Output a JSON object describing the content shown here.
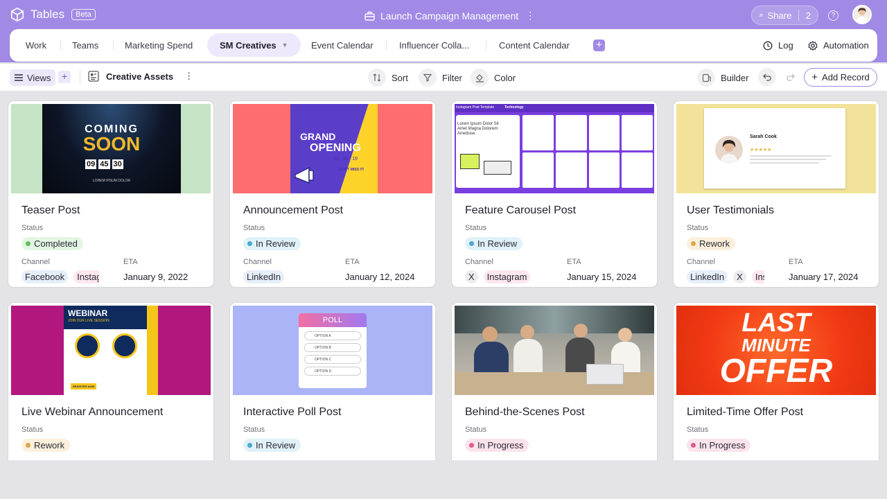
{
  "app": {
    "name": "Tables",
    "badge": "Beta"
  },
  "project": {
    "title": "Launch Campaign Management"
  },
  "share": {
    "label": "Share",
    "count": "2"
  },
  "tabs": [
    {
      "label": "Work"
    },
    {
      "label": "Teams"
    },
    {
      "label": "Marketing Spend"
    },
    {
      "label": "SM Creatives"
    },
    {
      "label": "Event Calendar"
    },
    {
      "label": "Influencer Colla..."
    },
    {
      "label": "Content Calendar"
    }
  ],
  "right_tabs": {
    "log": "Log",
    "automation": "Automation"
  },
  "toolbar": {
    "views": "Views",
    "table": "Creative Assets",
    "sort": "Sort",
    "filter": "Filter",
    "color": "Color",
    "builder": "Builder",
    "add_record": "Add Record"
  },
  "labels": {
    "status": "Status",
    "channel": "Channel",
    "eta": "ETA"
  },
  "cards": [
    {
      "title": "Teaser Post",
      "status": "Completed",
      "channels": [
        "Facebook",
        "Instagram"
      ],
      "eta": "January 9, 2022",
      "image": {
        "headline": "COMING",
        "subheadline": "SOON",
        "digits": [
          "09",
          "45",
          "30"
        ],
        "footer": "LOREM IPSUM DOLOR"
      }
    },
    {
      "title": "Announcement Post",
      "status": "In Review",
      "channels": [
        "LinkedIn"
      ],
      "eta": "January 12, 2024",
      "image": {
        "headline": "GRAND",
        "subheadline": "OPENING",
        "date": "12 . 06 . 19",
        "note": "DON'T MISS IT!"
      }
    },
    {
      "title": "Feature Carousel Post",
      "status": "In Review",
      "channels": [
        "X",
        "Instagram"
      ],
      "eta": "January 15, 2024",
      "image": {
        "header_left": "Instagram Post Template",
        "header_right": "Technology",
        "body": "Lorem Ipsum Dolor Sit Amet Magna Dolorem Amettuse."
      }
    },
    {
      "title": "User Testimonials",
      "status": "Rework",
      "channels": [
        "LinkedIn",
        "X",
        "Instagram"
      ],
      "eta": "January 17, 2024",
      "image": {
        "person": "Sarah Cook",
        "rating": "★★★★★"
      }
    },
    {
      "title": "Live Webinar Announcement",
      "status": "Rework",
      "channels": [],
      "eta": "",
      "image": {
        "headline": "WEBINAR",
        "subheadline": "JOIN OUR LIVE SESSION",
        "button": "REGISTER NOW"
      }
    },
    {
      "title": "Interactive Poll Post",
      "status": "In Review",
      "channels": [],
      "eta": "",
      "image": {
        "headline": "POLL",
        "options": [
          "OPTION A",
          "OPTION B",
          "OPTION C",
          "OPTION D"
        ]
      }
    },
    {
      "title": "Behind-the-Scenes Post",
      "status": "In Progress",
      "channels": [],
      "eta": "",
      "image": {}
    },
    {
      "title": "Limited-Time Offer Post",
      "status": "In Progress",
      "channels": [],
      "eta": "",
      "image": {
        "line1": "LAST",
        "line2": "MINUTE",
        "line3": "OFFER"
      }
    }
  ]
}
